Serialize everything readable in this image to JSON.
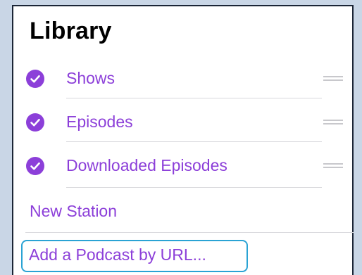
{
  "library": {
    "title": "Library",
    "items": [
      {
        "label": "Shows",
        "checked": true,
        "icon": "checkmark-icon",
        "handle_icon": "reorder-handle-icon"
      },
      {
        "label": "Episodes",
        "checked": true,
        "icon": "checkmark-icon",
        "handle_icon": "reorder-handle-icon"
      },
      {
        "label": "Downloaded Episodes",
        "checked": true,
        "icon": "checkmark-icon",
        "handle_icon": "reorder-handle-icon"
      }
    ],
    "new_station_label": "New Station",
    "add_podcast_label": "Add a Podcast by URL..."
  },
  "colors": {
    "accent": "#8c3fd9",
    "highlight": "#2aa3d4",
    "background": "#c9d6e6",
    "panel_border": "#1b2536"
  }
}
